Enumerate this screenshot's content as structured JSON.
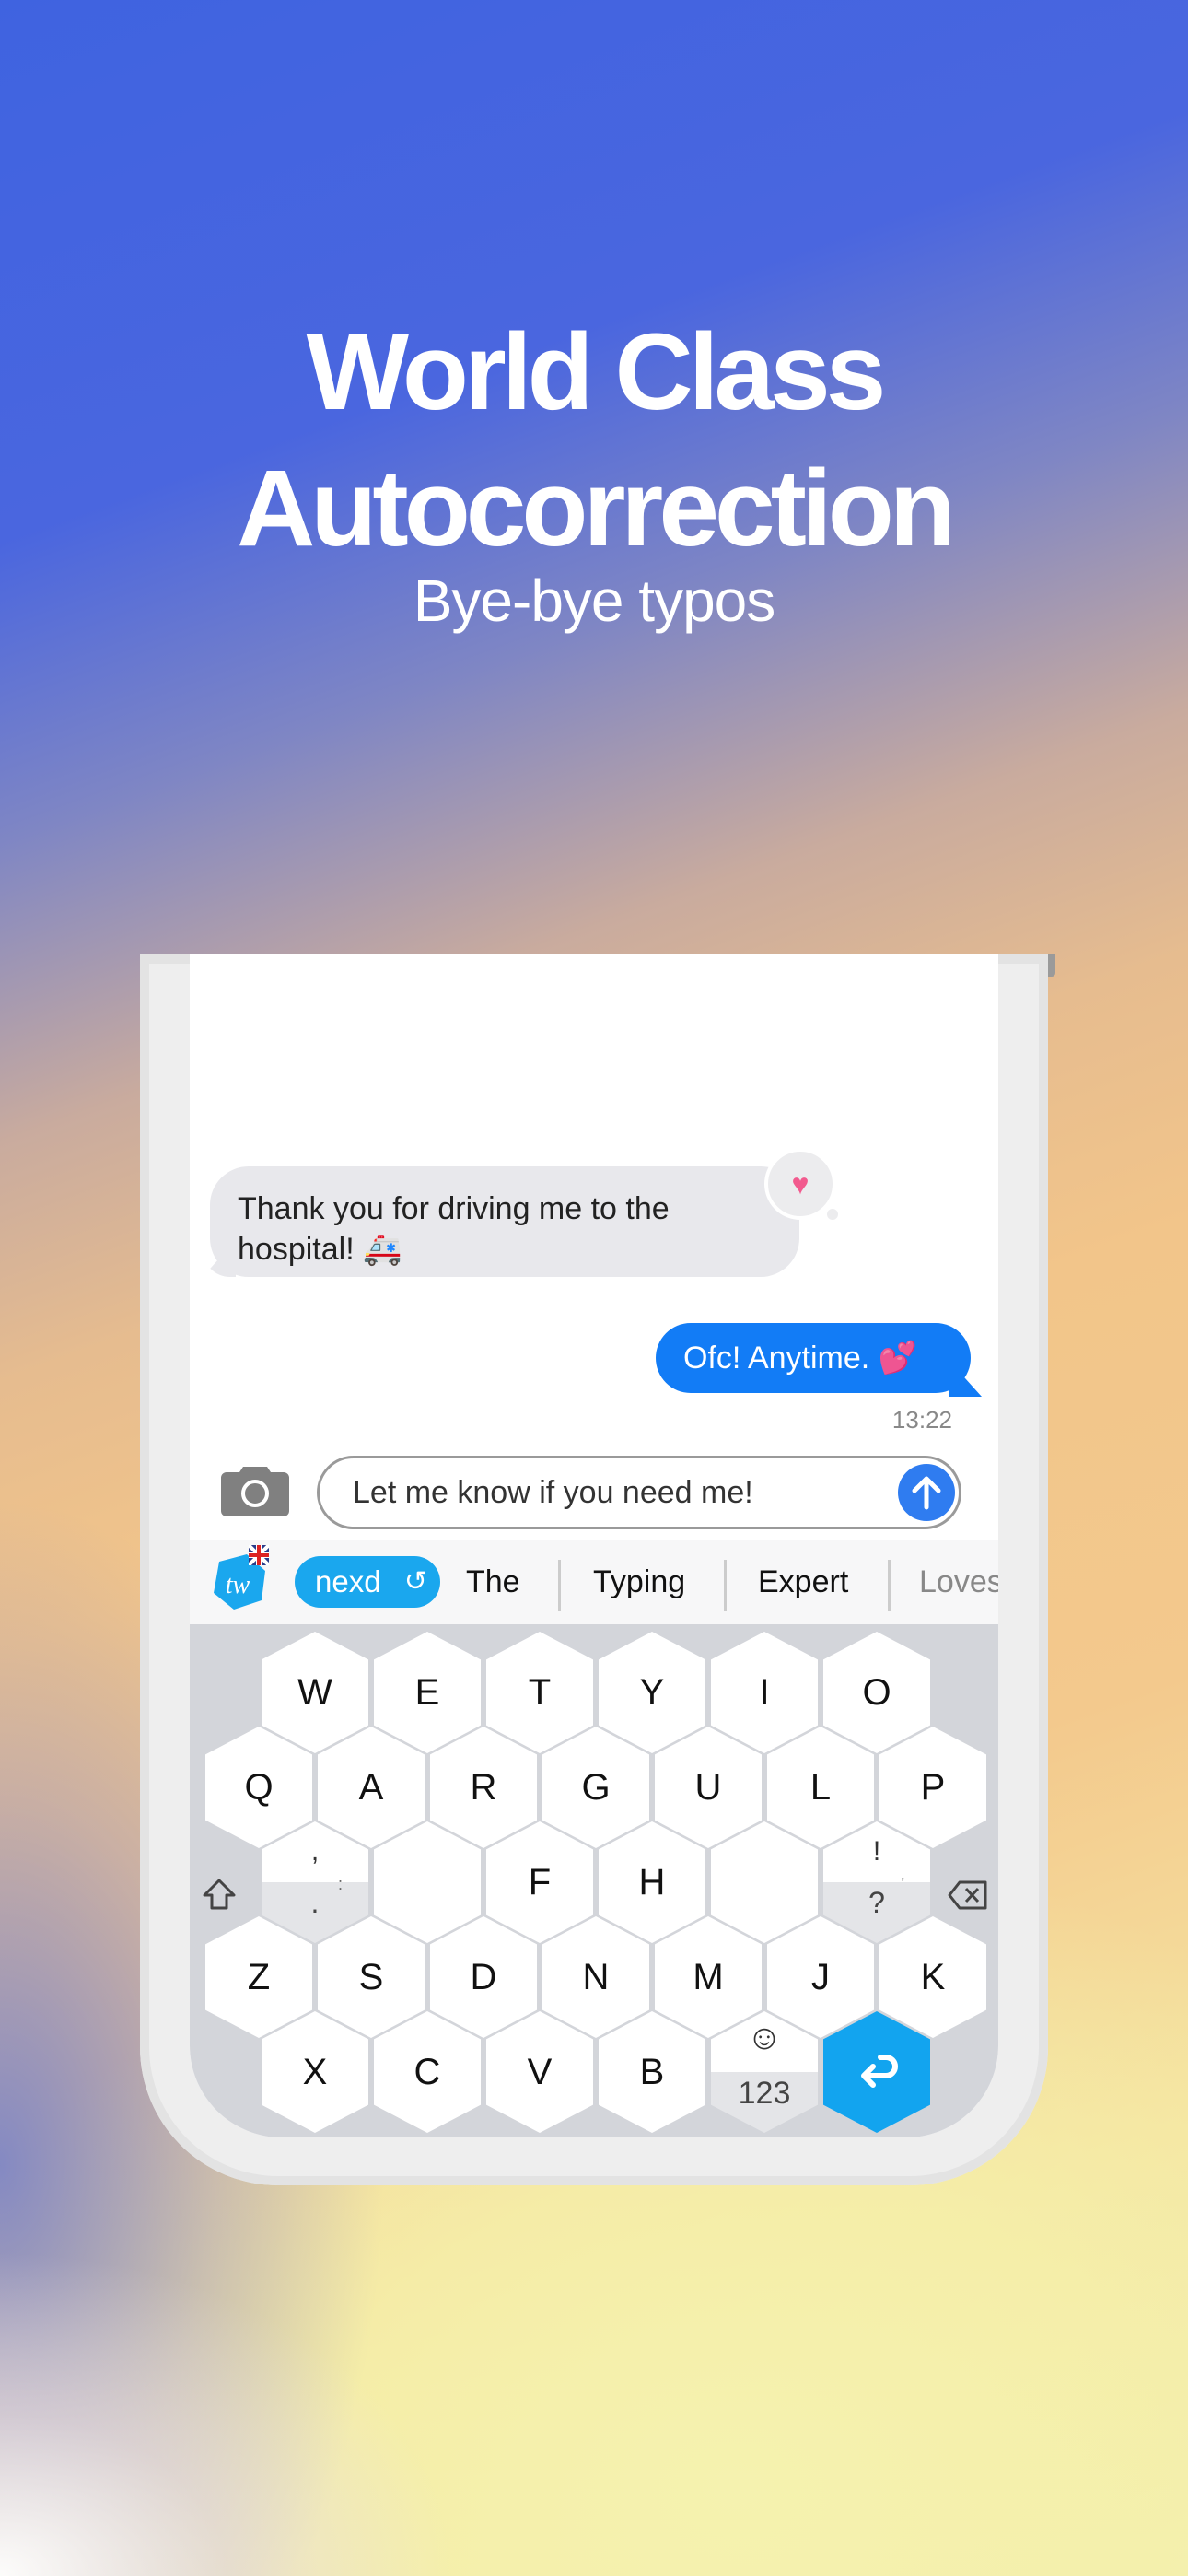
{
  "hero": {
    "title_line1": "World Class",
    "title_line2": "Autocorrection",
    "subtitle": "Bye-bye typos"
  },
  "chat": {
    "incoming": {
      "line1": "Thank you for driving me to the",
      "line2": "hospital! 🚑",
      "reaction_icon": "heart-icon",
      "reaction_glyph": "♥"
    },
    "outgoing": {
      "text": "Ofc! Anytime. 💕"
    },
    "timestamp": "13:22"
  },
  "composer": {
    "camera_icon": "camera-icon",
    "input_value": "Let me know if you need me!",
    "send_icon": "arrow-up-icon"
  },
  "suggestions": {
    "logo_text": "tw",
    "language_badge": "uk-flag",
    "original_word": "nexd",
    "undo_glyph": "↺",
    "items": [
      "The",
      "Typing",
      "Expert",
      "Loves"
    ]
  },
  "keyboard": {
    "rows": [
      [
        "W",
        "E",
        "T",
        "Y",
        "I",
        "O"
      ],
      [
        "Q",
        "A",
        "R",
        "G",
        "U",
        "L",
        "P"
      ],
      [
        "punct",
        "",
        "F",
        "H",
        "",
        "exclaim"
      ],
      [
        "Z",
        "S",
        "D",
        "N",
        "M",
        "J",
        "K"
      ],
      [
        "X",
        "C",
        "V",
        "B",
        "emoji123",
        "return"
      ]
    ],
    "punct_key": {
      "top": ",",
      "bottom": ".",
      "side": ":"
    },
    "exclaim_key": {
      "top": "!",
      "bottom": "?",
      "side": "'"
    },
    "emoji_key": {
      "top": "☺",
      "bottom": "123"
    },
    "shift_icon": "shift-icon",
    "backspace_icon": "backspace-icon",
    "return_icon": "return-icon",
    "accent_color": "#12a4ef"
  },
  "colors": {
    "outgoing_bubble": "#127cf6",
    "incoming_bubble": "#e8e8ec",
    "send_button": "#2f7cf0",
    "pill": "#1aa7ee"
  }
}
